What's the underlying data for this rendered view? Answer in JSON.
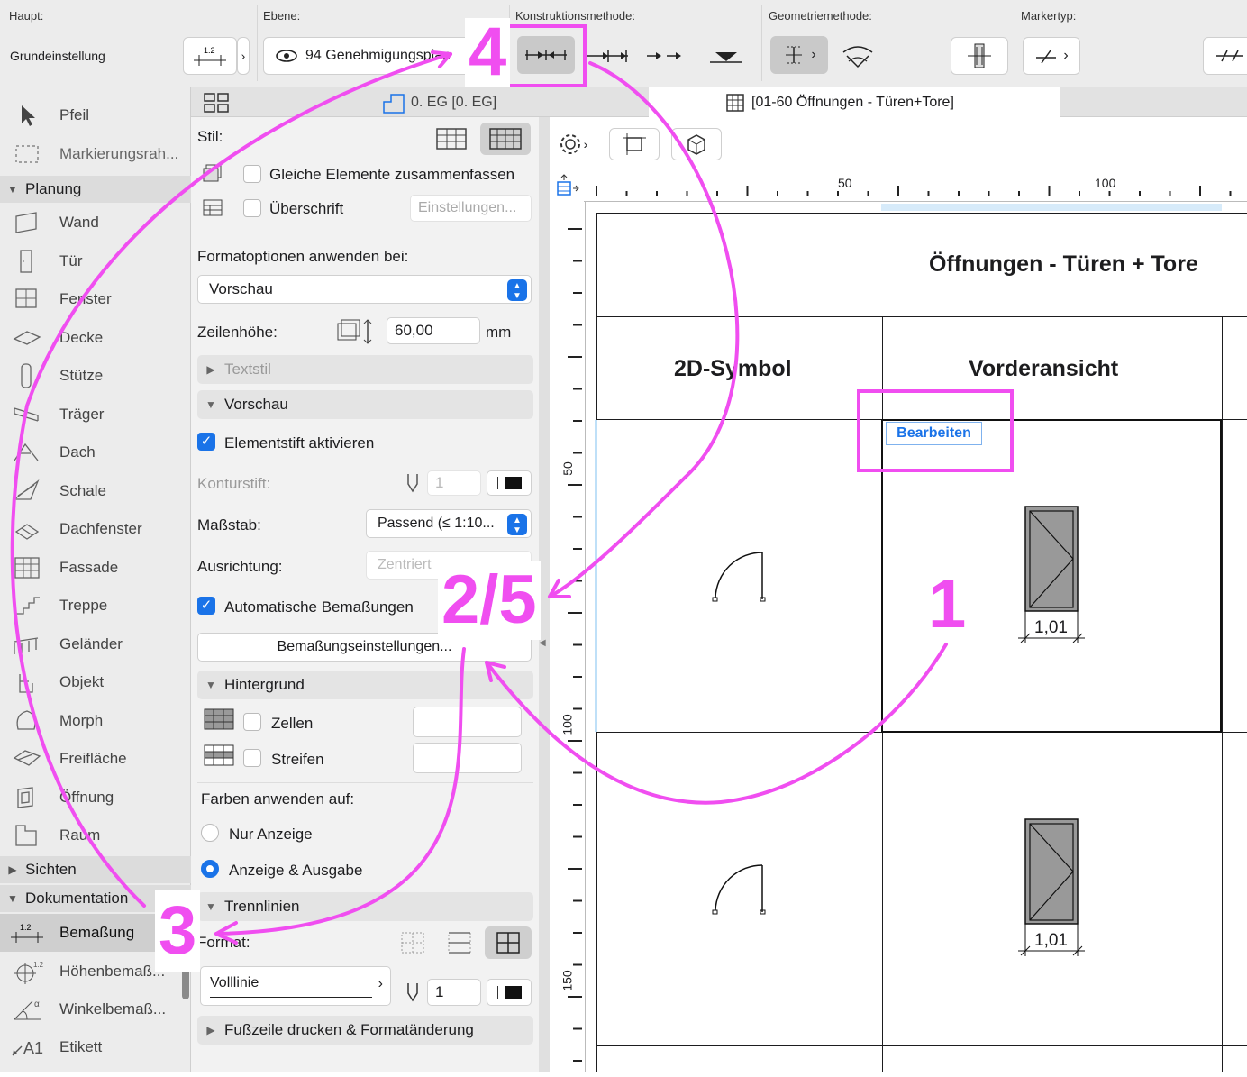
{
  "toolbar": {
    "haupt_label": "Haupt:",
    "haupt_value": "Grundeinstellung",
    "ebene_label": "Ebene:",
    "ebene_value": "94 Genehmigungsplan",
    "konstruktion_label": "Konstruktionsmethode:",
    "geometrie_label": "Geometriemethode:",
    "marker_label": "Markertyp:",
    "dim_icon_text": "1.2"
  },
  "tabs": {
    "floor": "0. EG [0. EG]",
    "schedule": "[01-60 Öffnungen - Türen+Tore]"
  },
  "toolbox": {
    "pfeil": "Pfeil",
    "markierung": "Markierungsrah...",
    "cat_planung": "Planung",
    "items": [
      "Wand",
      "Tür",
      "Fenster",
      "Decke",
      "Stütze",
      "Träger",
      "Dach",
      "Schale",
      "Dachfenster",
      "Fassade",
      "Treppe",
      "Geländer",
      "Objekt",
      "Morph",
      "Freifläche",
      "Öffnung",
      "Raum"
    ],
    "cat_sichten": "Sichten",
    "cat_dokumentation": "Dokumentation",
    "doc_items": [
      "Bemaßung",
      "Höhenbemaß...",
      "Winkelbemaß...",
      "Etikett"
    ]
  },
  "settings": {
    "stil": "Stil:",
    "gleiche": "Gleiche Elemente zusammenfassen",
    "ueberschrift": "Überschrift",
    "einstellungen": "Einstellungen...",
    "format_label": "Formatoptionen anwenden bei:",
    "format_value": "Vorschau",
    "zeilenhoehe": "Zeilenhöhe:",
    "zeilenhoehe_value": "60,00",
    "unit_mm": "mm",
    "textstil": "Textstil",
    "vorschau": "Vorschau",
    "elementstift": "Elementstift aktivieren",
    "konturstift": "Konturstift:",
    "kontur_value": "1",
    "massstab": "Maßstab:",
    "massstab_value": "Passend (≤ 1:10...",
    "ausrichtung": "Ausrichtung:",
    "ausrichtung_value": "Zentriert",
    "auto_bemass": "Automatische Bemaßungen",
    "bemass_settings": "Bemaßungseinstellungen...",
    "hintergrund": "Hintergrund",
    "zellen": "Zellen",
    "streifen": "Streifen",
    "farben_label": "Farben anwenden auf:",
    "nur_anzeige": "Nur Anzeige",
    "anzeige_ausgabe": "Anzeige & Ausgabe",
    "trennlinien": "Trennlinien",
    "format": "Format:",
    "linie_value": "Volllinie",
    "line_pen_value": "1",
    "fusszeile": "Fußzeile drucken & Formatänderung"
  },
  "schedule": {
    "title": "Öffnungen - Türen + Tore",
    "col1": "2D-Symbol",
    "col2": "Vorderansicht",
    "edit_button": "Bearbeiten",
    "dim1": "1,01",
    "dim2": "1,01",
    "ruler_h": [
      "50",
      "100"
    ],
    "ruler_v": [
      "50",
      "100",
      "150"
    ]
  },
  "annotations": {
    "a1": "1",
    "a25": "2/5",
    "a3": "3",
    "a4": "4"
  },
  "colors": {
    "annotation": "#f04ef0",
    "accent": "#1a73e8"
  }
}
